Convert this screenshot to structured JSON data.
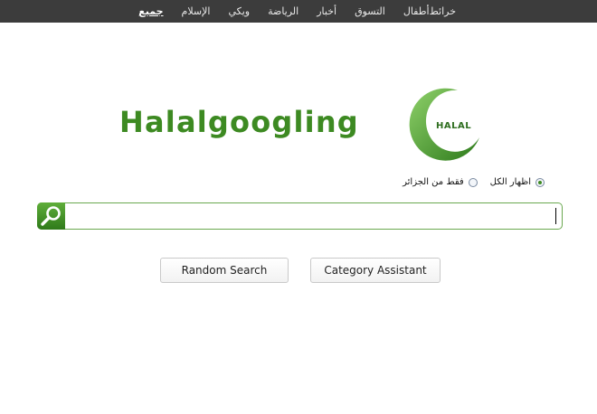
{
  "topbar": {
    "nav_items": [
      {
        "label": "جميع",
        "active": true
      },
      {
        "label": "الإسلام",
        "active": false
      },
      {
        "label": "ويكي",
        "active": false
      },
      {
        "label": "الرياضة",
        "active": false
      },
      {
        "label": "أخبار",
        "active": false
      },
      {
        "label": "التسوق",
        "active": false
      },
      {
        "label": "أطفال",
        "active": false
      },
      {
        "label": "خرائط",
        "active": false
      }
    ]
  },
  "logo": {
    "text": "Halalgoogling",
    "badge": "HALAL",
    "colors": {
      "green": "#3d8a22",
      "dark_green": "#2e6e1f"
    }
  },
  "search_scope": {
    "options": [
      {
        "label": "اظهار الكل",
        "checked": true
      },
      {
        "label": "فقط من الجزائر",
        "checked": false
      }
    ]
  },
  "search": {
    "value": "",
    "placeholder": "",
    "icon": "search-icon"
  },
  "buttons": {
    "random_label": "Random Search",
    "category_label": "Category Assistant"
  }
}
